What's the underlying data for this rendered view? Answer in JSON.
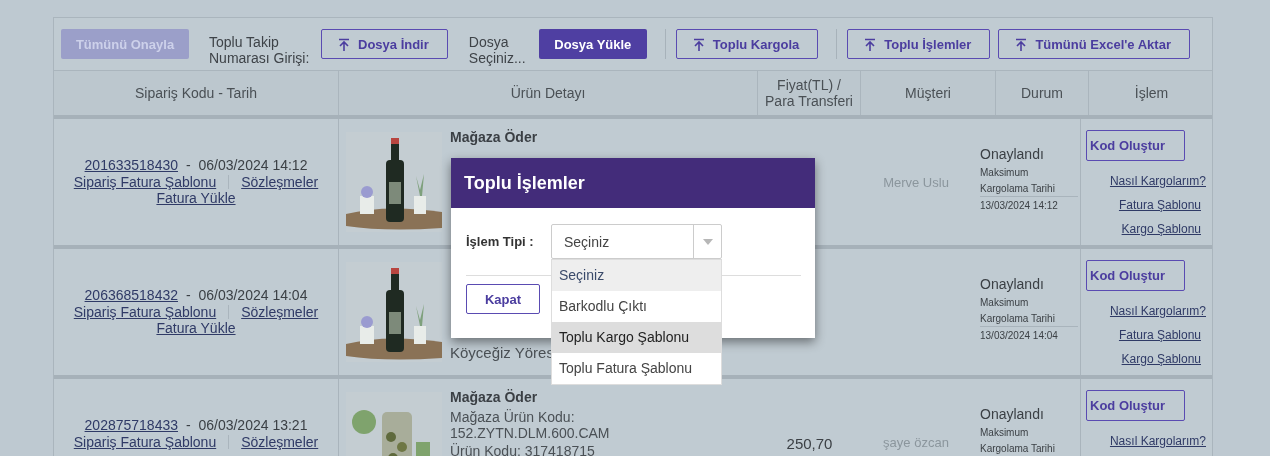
{
  "toolbar": {
    "items": [
      {
        "kind": "disabled_button",
        "text": "Tümünü Onayla"
      },
      {
        "kind": "text",
        "text": "Toplu Takip Numarası Girişi:"
      },
      {
        "kind": "outline_button",
        "text": "Dosya İndir"
      },
      {
        "kind": "text",
        "text": "Dosya Seçiniz..."
      },
      {
        "kind": "primary_button",
        "text": "Dosya Yükle"
      },
      {
        "kind": "separator"
      },
      {
        "kind": "outline_button",
        "text": "Toplu Kargola"
      },
      {
        "kind": "separator"
      },
      {
        "kind": "outline_button",
        "text": "Toplu İşlemler"
      },
      {
        "kind": "outline_button",
        "text": "Tümünü Excel'e Aktar"
      }
    ]
  },
  "table": {
    "columns": [
      "Sipariş Kodu - Tarih",
      "Ürün Detayı",
      "Fiyat(TL) / Para Transferi",
      "Müşteri",
      "Durum",
      "İşlem"
    ],
    "rows": [
      {
        "order_code": "201633518430",
        "date": "-  06/03/2024 14:12",
        "links": [
          "Sipariş Fatura Şablonu",
          "Sözleşmeler",
          "Fatura Yükle"
        ],
        "product": {
          "kind": "picture",
          "lines": [
            {
              "kind": "title",
              "text": "Mağaza Öder"
            }
          ]
        },
        "customer": "Merve Uslu",
        "status": "Onaylandı",
        "max_label": "Maksimum",
        "max_label_2": "Kargolama Tarihi",
        "max_date": "13/03/2024 14:12",
        "actions": [
          {
            "kind": "button",
            "text": "Kod Oluştur"
          },
          {
            "kind": "link",
            "text": "Nasıl Kargolarım?"
          },
          {
            "kind": "link",
            "text": "Fatura Şablonu"
          },
          {
            "kind": "link",
            "text": "Kargo Şablonu"
          }
        ]
      },
      {
        "order_code": "206368518432",
        "date": "-  06/03/2024 14:04",
        "links": [
          "Sipariş Fatura Şablonu",
          "Sözleşmeler",
          "Fatura Yükle"
        ],
        "product": {
          "kind": "picture",
          "lines": [
            {
              "kind": "footer",
              "text": "Köyceğiz Yöres"
            }
          ]
        },
        "status": "Onaylandı",
        "max_label": "Maksimum",
        "max_label_2": "Kargolama Tarihi",
        "max_date": "13/03/2024 14:04",
        "actions": [
          {
            "kind": "button",
            "text": "Kod Oluştur"
          },
          {
            "kind": "link",
            "text": "Nasıl Kargolarım?"
          },
          {
            "kind": "link",
            "text": "Fatura Şablonu"
          },
          {
            "kind": "link",
            "text": "Kargo Şablonu"
          }
        ]
      },
      {
        "order_code": "202875718433",
        "date": "-  06/03/2024 13:21",
        "links": [
          "Sipariş Fatura Şablonu",
          "Sözleşmeler"
        ],
        "product": {
          "kind": "picture",
          "lines": [
            {
              "kind": "title",
              "text": "Mağaza Öder"
            },
            {
              "kind": "text",
              "text": "Mağaza Ürün Kodu: 152.ZYTN.DLM.600.CAM"
            },
            {
              "kind": "text",
              "text": "Ürün Kodu: 317418715"
            }
          ]
        },
        "price": "250,70",
        "customer": "şaye özcan",
        "status": "Onaylandı",
        "max_label": "Maksimum",
        "max_label_2": "Kargolama Tarihi",
        "actions": [
          {
            "kind": "button",
            "text": "Kod Oluştur"
          },
          {
            "kind": "link",
            "text": "Nasıl Kargolarım?"
          }
        ]
      }
    ]
  },
  "modal": {
    "title": "Toplu İşlemler",
    "field_label": "İşlem Tipi :",
    "select": {
      "value": "Seçiniz",
      "expanded": true,
      "options": [
        {
          "text": "Seçiniz",
          "selected": true,
          "highlighted": false
        },
        {
          "text": "Barkodlu Çıktı",
          "selected": false,
          "highlighted": false
        },
        {
          "text": "Toplu Kargo Şablonu",
          "selected": false,
          "highlighted": true
        },
        {
          "text": "Toplu Fatura Şablonu",
          "selected": false,
          "highlighted": false
        }
      ]
    },
    "close_button": "Kapat"
  }
}
